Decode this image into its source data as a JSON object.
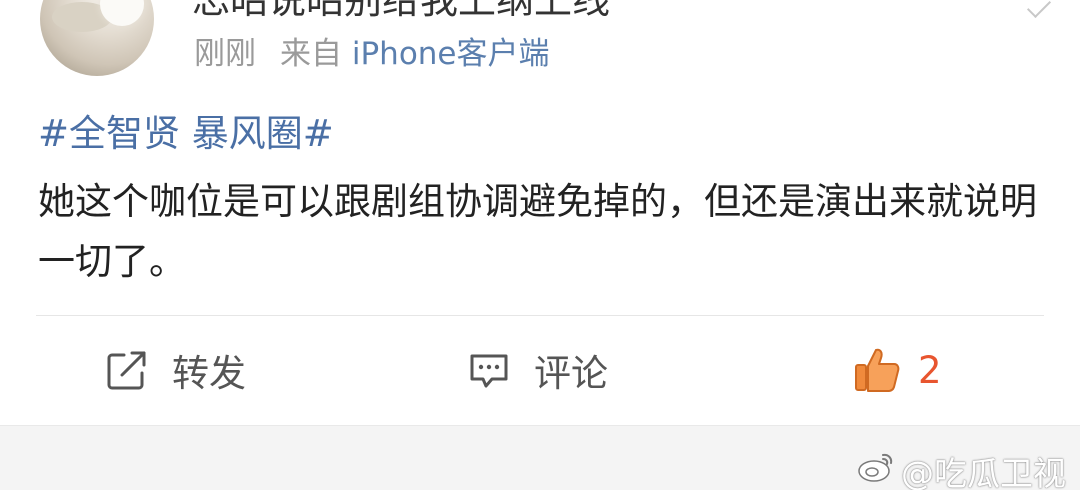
{
  "post": {
    "username": "忘昭说昭别给我上纲上线",
    "time": "刚刚",
    "source_prefix": "来自",
    "source_client": "iPhone客户端",
    "topic": "#全智贤 暴风圈#",
    "content": "她这个咖位是可以跟剧组协调避免掉的，但还是演出来就说明一切了。"
  },
  "actions": {
    "repost_label": "转发",
    "comment_label": "评论",
    "like_count": "2"
  },
  "watermark": {
    "text": "@吃瓜卫视"
  },
  "colors": {
    "link": "#4a6fa5",
    "meta": "#9a9a9a",
    "like_accent": "#e8552f",
    "like_icon": "#f08a3c"
  }
}
